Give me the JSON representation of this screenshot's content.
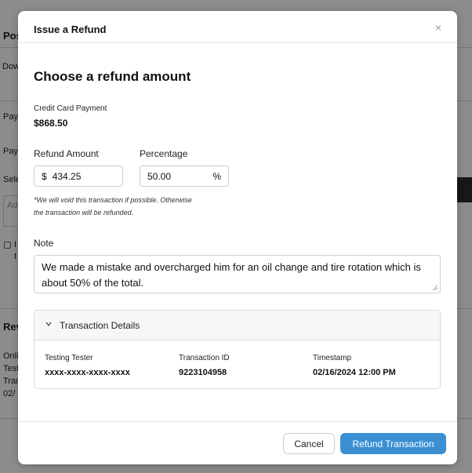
{
  "background": {
    "title": "Pos",
    "row1": "Dow",
    "row2": "Pay",
    "row3": "Pay",
    "row4": "Sele",
    "input_placeholder": "Ad",
    "check_text1": "I",
    "check_text2": "t",
    "section2_title": "Rev",
    "list": [
      "Onli",
      "Test",
      "Tran",
      "02/"
    ]
  },
  "modal": {
    "title": "Issue a Refund",
    "close_symbol": "×",
    "heading": "Choose a refund amount",
    "payment_label": "Credit Card Payment",
    "payment_amount": "$868.50",
    "refund_amount": {
      "label": "Refund Amount",
      "prefix": "$",
      "value": "434.25"
    },
    "percentage": {
      "label": "Percentage",
      "value": "50.00",
      "suffix": "%"
    },
    "disclaimer_line1": "*We will void this transaction if possible. Otherwise",
    "disclaimer_line2": "the transaction will be refunded.",
    "note": {
      "label": "Note",
      "value": "We made a mistake and overcharged him for an oil change and tire rotation which is about 50% of the total."
    },
    "transaction_details": {
      "title": "Transaction Details",
      "expanded": true,
      "fields": [
        {
          "label": "Testing Tester",
          "value": "xxxx-xxxx-xxxx-xxxx"
        },
        {
          "label": "Transaction ID",
          "value": "9223104958"
        },
        {
          "label": "Timestamp",
          "value": "02/16/2024 12:00 PM"
        }
      ]
    },
    "buttons": {
      "cancel": "Cancel",
      "refund": "Refund Transaction"
    },
    "colors": {
      "primary": "#3a8fd3",
      "overlay": "rgba(0,0,0,0.45)"
    }
  }
}
